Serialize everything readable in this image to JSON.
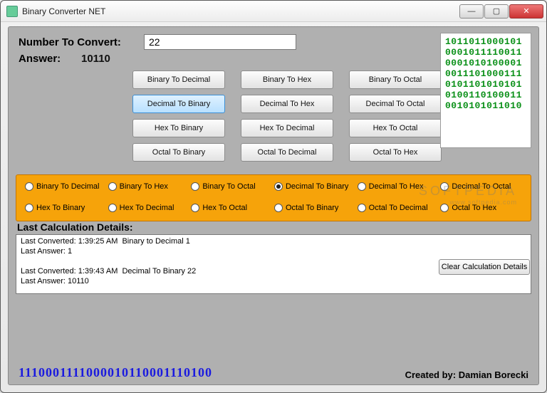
{
  "window": {
    "title": "Binary Converter NET"
  },
  "labels": {
    "number_to_convert": "Number To Convert:",
    "answer": "Answer:",
    "last_details": "Last Calculation Details:",
    "clear": "Clear Calculation Details",
    "created_by": "Created by: Damian Borecki"
  },
  "input": {
    "value": "22"
  },
  "answer_value": "10110",
  "buttons": [
    "Binary To Decimal",
    "Binary To Hex",
    "Binary To Octal",
    "Decimal To Binary",
    "Decimal To Hex",
    "Decimal To Octal",
    "Hex To Binary",
    "Hex To Decimal",
    "Hex To Octal",
    "Octal To Binary",
    "Octal To Decimal",
    "Octal To Hex"
  ],
  "selected_button_index": 3,
  "radios": [
    "Binary To Decimal",
    "Binary To Hex",
    "Binary To Octal",
    "Decimal To Binary",
    "Decimal To Hex",
    "Decimal To Octal",
    "Hex To Binary",
    "Hex To Decimal",
    "Hex To Octal",
    "Octal To Binary",
    "Octal To Decimal",
    "Octal To Hex"
  ],
  "selected_radio_index": 3,
  "binary_art": "1011011000101\n0001011110011\n0001010100001\n0011101000111\n0101101010101\n0100110100011\n0010101011010",
  "details_text": "Last Converted: 1:39:25 AM  Binary to Decimal 1\nLast Answer: 1\n\nLast Converted: 1:39:43 AM  Decimal To Binary 22\nLast Answer: 10110",
  "footer_binary": "1110001111000010110001110100",
  "watermark": {
    "main": "SOFTPEDIA",
    "sub": "www.softpedia.com"
  }
}
